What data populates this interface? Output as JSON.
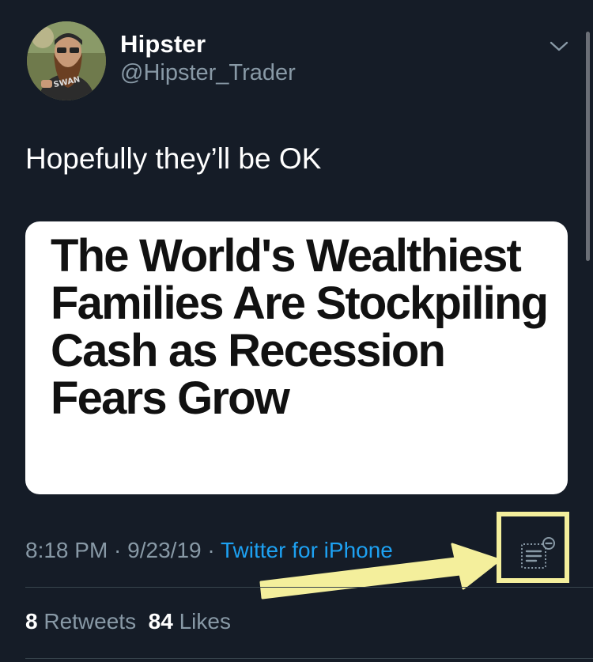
{
  "tweet": {
    "display_name": "Hipster",
    "handle": "@Hipster_Trader",
    "avatar_shirt_text": "SWAN",
    "text": "Hopefully they’ll be OK",
    "card_headline": "The World's Wealthiest Families Are Stockpiling Cash as Recession Fears Grow",
    "time": "8:18 PM",
    "date": "9/23/19",
    "separator": " · ",
    "source": "Twitter for iPhone",
    "retweet_count": "8",
    "retweet_label": "Retweets",
    "like_count": "84",
    "like_label": "Likes"
  },
  "icons": {
    "menu": "chevron-down-icon",
    "analytics": "tweet-analytics-icon",
    "annotation": "arrow-annotation"
  },
  "colors": {
    "background": "#151c27",
    "link": "#1da1f2",
    "secondary_text": "#8899a6",
    "highlight": "#f4ef9c"
  }
}
